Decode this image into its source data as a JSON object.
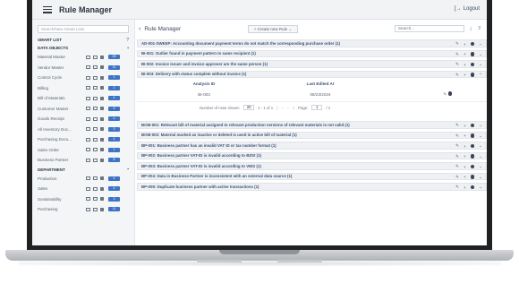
{
  "app": {
    "title": "Rule Manager",
    "logout_label": "Logout"
  },
  "sidebar": {
    "search_placeholder": "Search/New Smart Lists",
    "smart_list_label": "SMART LIST",
    "data_objects_label": "DATA OBJECTS",
    "department_label": "DEPARTMENT",
    "data_objects": [
      {
        "label": "Material Master",
        "count": "28"
      },
      {
        "label": "Vendor Master",
        "count": "11"
      },
      {
        "label": "Control Cycle",
        "count": "1"
      },
      {
        "label": "Billing",
        "count": "2"
      },
      {
        "label": "Bill of Materials",
        "count": "4"
      },
      {
        "label": "Customer Master",
        "count": "9"
      },
      {
        "label": "Goods Receipt",
        "count": "4"
      },
      {
        "label": "All Inventory Doc...",
        "count": "3"
      },
      {
        "label": "Purchasing Docu...",
        "count": "4"
      },
      {
        "label": "Sales Order",
        "count": "1"
      },
      {
        "label": "Business Partner",
        "count": "8"
      }
    ],
    "departments": [
      {
        "label": "Production",
        "count": "4"
      },
      {
        "label": "Sales",
        "count": "4"
      },
      {
        "label": "Sustainability",
        "count": "3"
      },
      {
        "label": "Purchasing",
        "count": "11"
      }
    ]
  },
  "main": {
    "back_icon": "chevron-left-icon",
    "title": "Rule Manager",
    "create_button": "+ Create new Rule ⌄",
    "search_placeholder": "Search...",
    "rules_before": [
      "AD-001-SWEEP: Accounting document payment terms do not match the corresponding purchase order (1)",
      "BI-001: Outlier found in payment pattern to same recipient (1)",
      "BI-002: Invoice issuer and invoice approver are the same person (1)",
      "BI-003: Delivery with status complete without invoice (1)"
    ],
    "expanded": {
      "col_analysis": "Analysis ID",
      "col_last_edited": "Last Edited At",
      "analysis_id": "BI-003",
      "last_edited": "08/23/2024",
      "pager_label": "Number of rows shown:",
      "rows_value": "20",
      "range": "1 - 1 of 1",
      "page_label": "Page:",
      "page_value": "1",
      "page_total": "/ 1"
    },
    "rules_after": [
      "BOM-001: Relevant bill of material assigned to relevant production versions of relevant materials is not valid (1)",
      "BOM-002: Material marked as inactive or deleted is used in active bill of material (1)",
      "BP-001: Business partner has an invalid VAT ID or tax number format (1)",
      "BP-002: Business partner VAT-ID is invalid according to BZSt (1)",
      "BP-003: Business partner VAT-ID is invalid according to VIES (1)",
      "BP-004: Data in Business Partner is inconsistent with an external data source (1)",
      "BP-005: Duplicate business partner with active transactions (1)"
    ]
  }
}
